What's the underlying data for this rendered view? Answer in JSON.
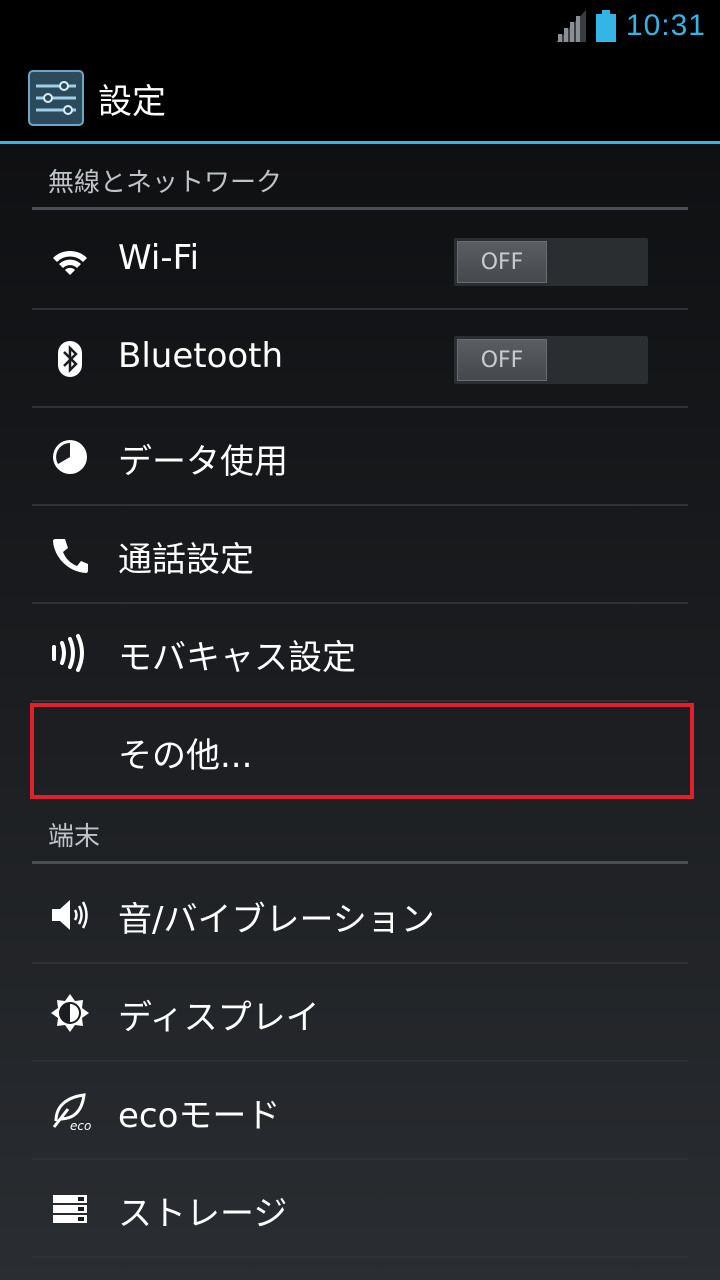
{
  "status_bar": {
    "time": "10:31"
  },
  "action_bar": {
    "title": "設定"
  },
  "sections": [
    {
      "header": "無線とネットワーク"
    },
    {
      "header": "端末"
    }
  ],
  "wireless_items": [
    {
      "label": "Wi-Fi",
      "toggle": "OFF"
    },
    {
      "label": "Bluetooth",
      "toggle": "OFF"
    },
    {
      "label": "データ使用"
    },
    {
      "label": "通話設定"
    },
    {
      "label": "モバキャス設定"
    },
    {
      "label": "その他..."
    }
  ],
  "device_items": [
    {
      "label": "音/バイブレーション"
    },
    {
      "label": "ディスプレイ"
    },
    {
      "label": "ecoモード"
    },
    {
      "label": "ストレージ"
    }
  ],
  "colors": {
    "accent": "#33b5e5",
    "highlight": "#e0212b"
  },
  "icons": [
    "wifi-icon",
    "bluetooth-icon",
    "data-usage-icon",
    "phone-icon",
    "mobacas-icon",
    "sound-icon",
    "display-icon",
    "eco-icon",
    "storage-icon"
  ]
}
